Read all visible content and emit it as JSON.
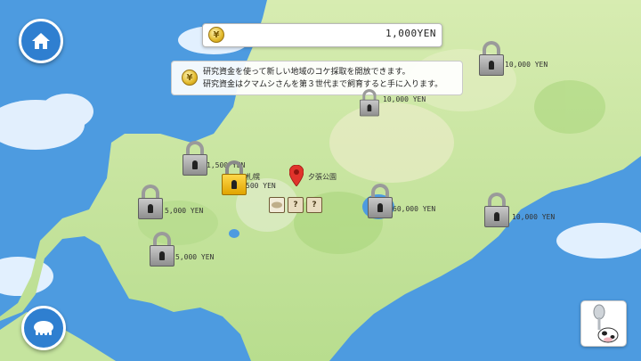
{
  "hud": {
    "money": "1,000YEN",
    "info_lines": [
      "研究資金を使って新しい地域のコケ採取を開放できます。",
      "研究資金はクマムシさんを第３世代まで飼育すると手に入ります。"
    ],
    "coin_symbol": "¥"
  },
  "map": {
    "current_location": "夕張公園",
    "city_label": "札幌",
    "slot_unknown_symbol": "?",
    "regions": [
      {
        "id": "region-1",
        "price": "10,000 YEN",
        "state": "locked"
      },
      {
        "id": "region-2",
        "price": "10,000 YEN",
        "state": "locked"
      },
      {
        "id": "region-3",
        "price": "1,500 YEN",
        "state": "locked"
      },
      {
        "id": "region-4",
        "price": "500 YEN",
        "state": "available"
      },
      {
        "id": "region-5",
        "price": "5,000 YEN",
        "state": "locked"
      },
      {
        "id": "region-6",
        "price": "5,000 YEN",
        "state": "locked"
      },
      {
        "id": "region-7",
        "price": "60,000 YEN",
        "state": "locked"
      },
      {
        "id": "region-8",
        "price": "10,000 YEN",
        "state": "locked"
      }
    ]
  },
  "colors": {
    "sea": "#4d9be0",
    "land": "#cfe7a9",
    "button": "#2f7fd0",
    "gold_lock": "#f1c01c"
  },
  "icons": [
    "home-icon",
    "tardigrade-icon",
    "coin-icon",
    "lock-icon",
    "map-pin-icon",
    "cow-spoon-icon"
  ]
}
